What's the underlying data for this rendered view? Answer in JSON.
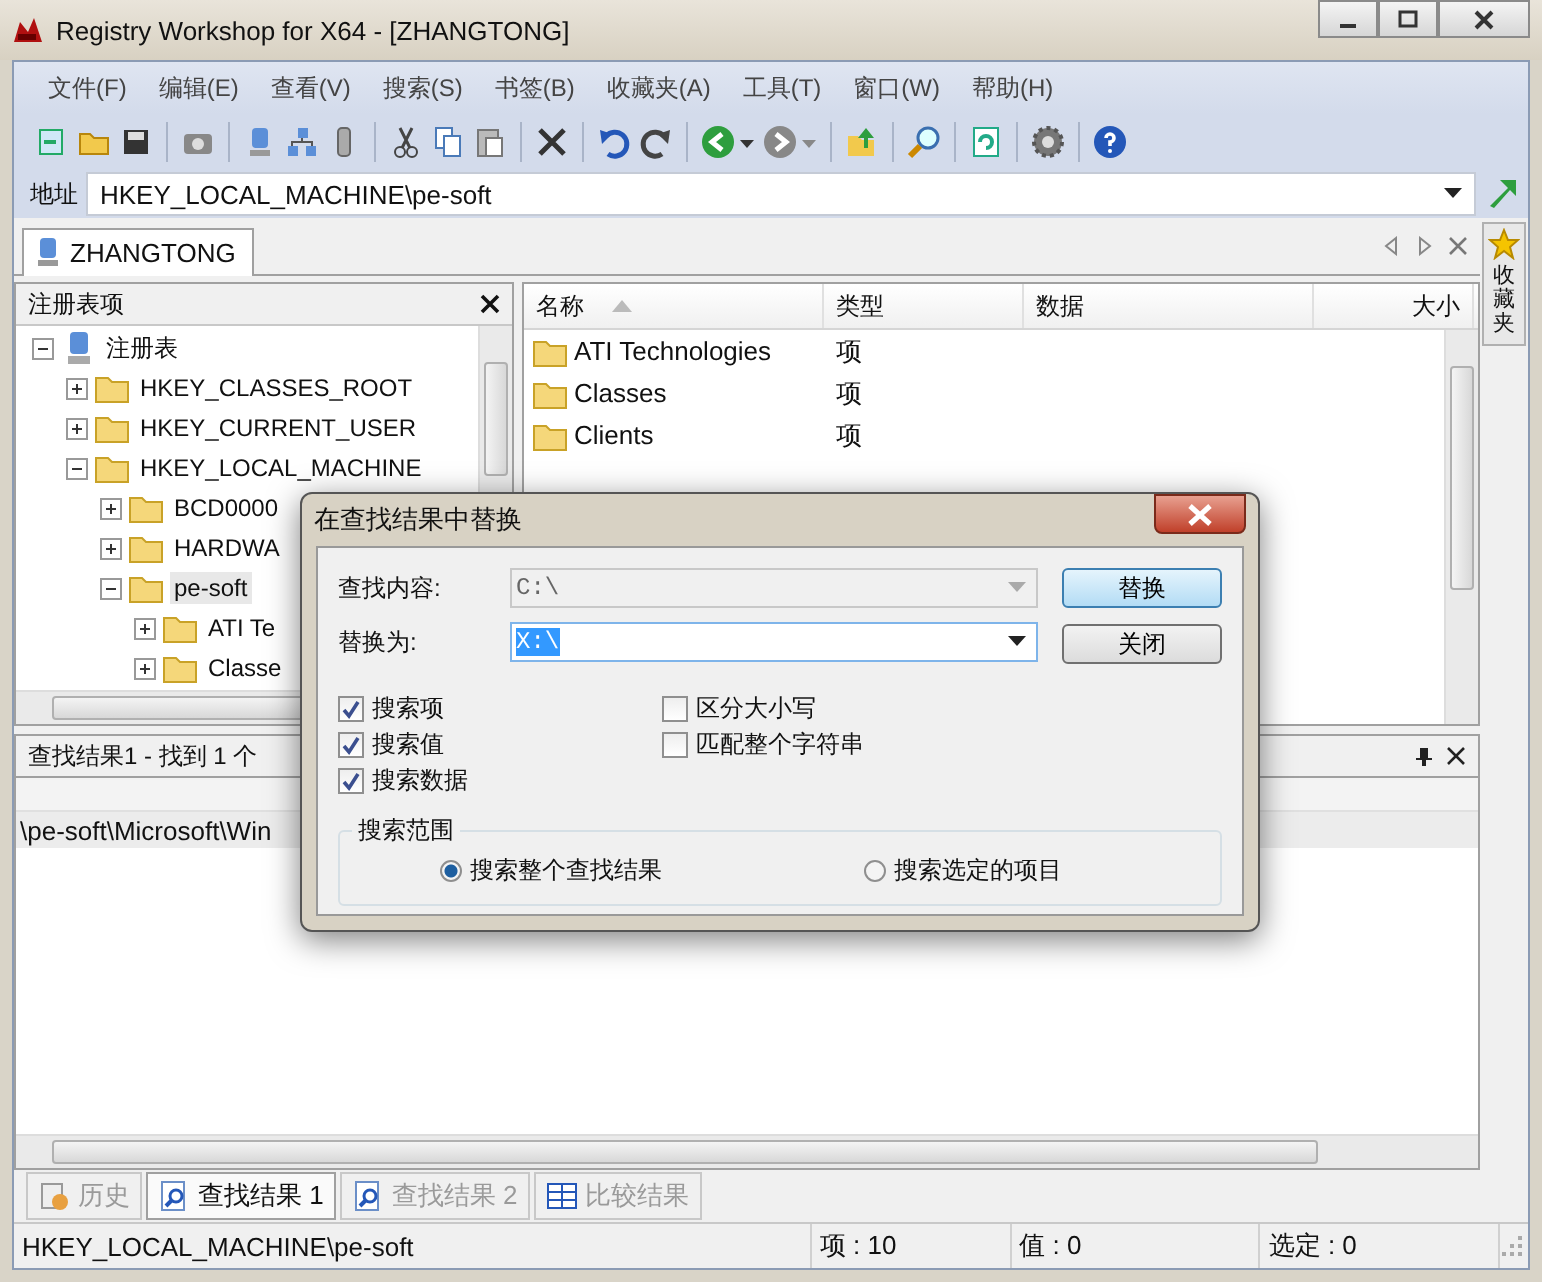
{
  "window": {
    "title": "Registry Workshop for X64 - [ZHANGTONG]"
  },
  "menu": [
    "文件(F)",
    "编辑(E)",
    "查看(V)",
    "搜索(S)",
    "书签(B)",
    "收藏夹(A)",
    "工具(T)",
    "窗口(W)",
    "帮助(H)"
  ],
  "address": {
    "label": "地址",
    "value": "HKEY_LOCAL_MACHINE\\pe-soft"
  },
  "document_tab": {
    "label": "ZHANGTONG"
  },
  "side_tab": {
    "label": "收藏夹"
  },
  "tree_panel": {
    "title": "注册表项",
    "items": [
      {
        "label": "注册表",
        "kind": "computer",
        "expanded": true,
        "selected": false,
        "children": [
          {
            "label": "HKEY_CLASSES_ROOT",
            "kind": "folder",
            "expanded": false,
            "selected": false
          },
          {
            "label": "HKEY_CURRENT_USER",
            "kind": "folder",
            "expanded": false,
            "selected": false
          },
          {
            "label": "HKEY_LOCAL_MACHINE",
            "kind": "folder",
            "expanded": true,
            "selected": false,
            "children": [
              {
                "label": "BCD0000",
                "kind": "folder",
                "expanded": false,
                "selected": false
              },
              {
                "label": "HARDWA",
                "kind": "folder",
                "expanded": false,
                "selected": false
              },
              {
                "label": "pe-soft",
                "kind": "folder",
                "expanded": true,
                "selected": true,
                "children": [
                  {
                    "label": "ATI Te",
                    "kind": "folder",
                    "expanded": false,
                    "selected": false
                  },
                  {
                    "label": "Classe",
                    "kind": "folder",
                    "expanded": false,
                    "selected": false
                  }
                ]
              }
            ]
          }
        ]
      }
    ]
  },
  "list": {
    "columns": [
      {
        "label": "名称",
        "sorted": true
      },
      {
        "label": "类型",
        "sorted": false
      },
      {
        "label": "数据",
        "sorted": false
      },
      {
        "label": "大小",
        "sorted": false
      }
    ],
    "rows": [
      {
        "name": "ATI Technologies",
        "type": "项"
      },
      {
        "name": "Classes",
        "type": "项"
      },
      {
        "name": "Clients",
        "type": "项"
      }
    ]
  },
  "results_panel": {
    "title": "查找结果1 - 找到 1 个",
    "rows": [
      {
        "text": "\\pe-soft\\Microsoft\\Win",
        "selected": true
      }
    ]
  },
  "bottom_tabs": [
    {
      "label": "历史",
      "selected": false,
      "disabled": true
    },
    {
      "label": "查找结果 1",
      "selected": true,
      "disabled": false
    },
    {
      "label": "查找结果 2",
      "selected": false,
      "disabled": true
    },
    {
      "label": "比较结果",
      "selected": false,
      "disabled": true
    }
  ],
  "status_bar": [
    "HKEY_LOCAL_MACHINE\\pe-soft",
    "项 : 10",
    "值 : 0",
    "选定 : 0"
  ],
  "dialog": {
    "title": "在查找结果中替换",
    "find": {
      "label": "查找内容:",
      "value": "C:\\",
      "disabled": true
    },
    "replace": {
      "label": "替换为:",
      "value": "X:\\",
      "disabled": false
    },
    "buttons": [
      {
        "label": "替换",
        "default": true
      },
      {
        "label": "关闭",
        "default": false
      }
    ],
    "options_left": [
      {
        "label": "搜索项",
        "checked": true
      },
      {
        "label": "搜索值",
        "checked": true
      },
      {
        "label": "搜索数据",
        "checked": true
      }
    ],
    "options_right": [
      {
        "label": "区分大小写",
        "checked": false
      },
      {
        "label": "匹配整个字符串",
        "checked": false
      }
    ],
    "scope": {
      "title": "搜索范围",
      "options": [
        {
          "label": "搜索整个查找结果",
          "selected": true
        },
        {
          "label": "搜索选定的项目",
          "selected": false
        }
      ]
    }
  }
}
